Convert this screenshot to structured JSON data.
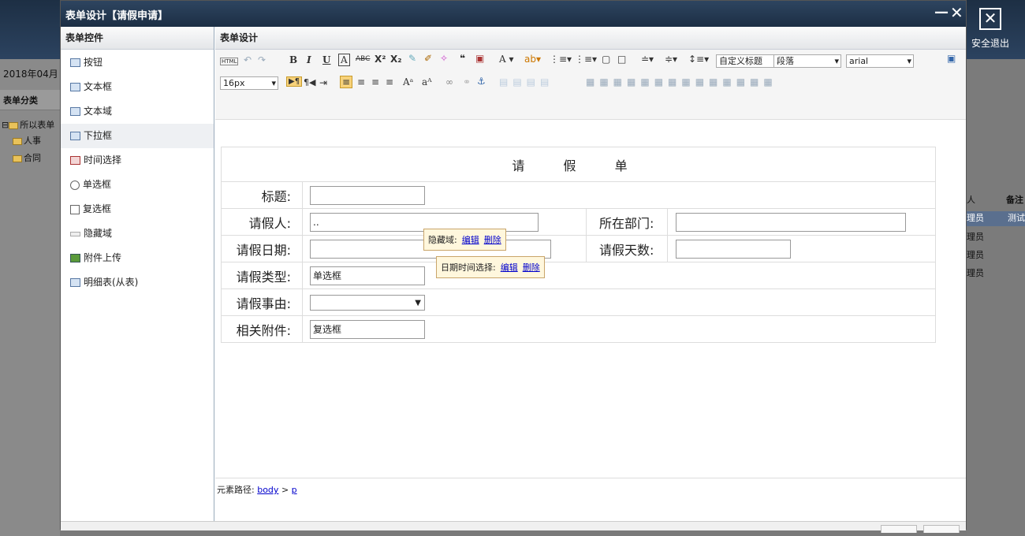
{
  "background": {
    "date_text": "2018年04月",
    "category_title": "表单分类",
    "tree": [
      "所以表单",
      "人事",
      "合同"
    ],
    "exit_label": "安全退出",
    "right_headers": [
      "人",
      "备注"
    ],
    "right_rows": [
      "理员",
      "理员",
      "理员",
      "理员"
    ],
    "right_row_note": "测试"
  },
  "dialog": {
    "title": "表单设计【请假申请】",
    "minimize_icon": "—",
    "close_icon": "✕"
  },
  "left_panel": {
    "header": "表单控件",
    "items": [
      {
        "label": "按钮",
        "icon": "button-icon"
      },
      {
        "label": "文本框",
        "icon": "textbox-icon"
      },
      {
        "label": "文本域",
        "icon": "textarea-icon"
      },
      {
        "label": "下拉框",
        "icon": "dropdown-icon"
      },
      {
        "label": "时间选择",
        "icon": "calendar-icon"
      },
      {
        "label": "单选框",
        "icon": "radio-icon"
      },
      {
        "label": "复选框",
        "icon": "checkbox-icon"
      },
      {
        "label": "隐藏域",
        "icon": "hidden-field-icon"
      },
      {
        "label": "附件上传",
        "icon": "upload-icon"
      },
      {
        "label": "明细表(从表)",
        "icon": "table-icon"
      }
    ]
  },
  "main_panel": {
    "header": "表单设计",
    "toolbar": {
      "custom_title_select": "自定义标题",
      "paragraph_select": "段落",
      "font_select": "arial",
      "size_select": "16px",
      "html_label": "HTML"
    }
  },
  "form": {
    "title": "请 假 单",
    "rows": {
      "title_label": "标题:",
      "applicant_label": "请假人:",
      "applicant_value": "..",
      "department_label": "所在部门:",
      "date_label": "请假日期:",
      "days_label": "请假天数:",
      "type_label": "请假类型:",
      "type_value": "单选框",
      "reason_label": "请假事由:",
      "reason_value": "",
      "attachment_label": "相关附件:",
      "attachment_value": "复选框"
    },
    "popup_hidden": {
      "label": "隐藏域:",
      "edit": "编辑",
      "delete": "删除"
    },
    "popup_date": {
      "label": "日期时间选择:",
      "edit": "编辑",
      "delete": "删除"
    }
  },
  "statusbar": {
    "path_label": "元素路径:",
    "path_body": "body",
    "path_sep": ">",
    "path_p": "p"
  }
}
